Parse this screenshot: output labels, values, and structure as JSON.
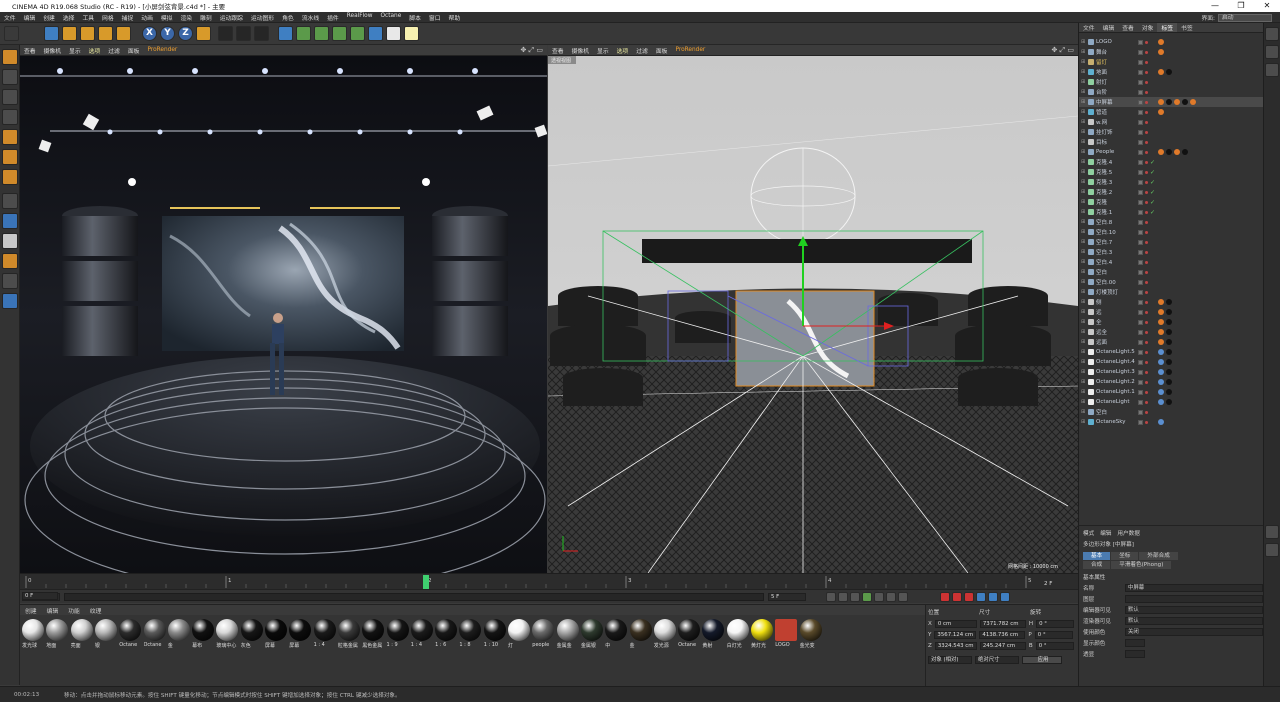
{
  "window": {
    "title": "CINEMA 4D R19.068 Studio (RC - R19) - [小屏剑弦背景.c4d *] - 主要",
    "controls": [
      "—",
      "❐",
      "✕"
    ]
  },
  "menubar": {
    "items": [
      "文件",
      "编辑",
      "创建",
      "选择",
      "工具",
      "网格",
      "捕捉",
      "动画",
      "模拟",
      "渲染",
      "雕刻",
      "运动跟踪",
      "运动图形",
      "角色",
      "流水线",
      "插件",
      "RealFlow",
      "Octane",
      "脚本",
      "窗口",
      "帮助"
    ],
    "layout_label": "界面:",
    "layout_value": "启动"
  },
  "viewport_left": {
    "menu": [
      "查看",
      "摄像机",
      "显示",
      "选项",
      "过滤",
      "面板"
    ],
    "prorender": "ProRender"
  },
  "viewport_right": {
    "menu": [
      "查看",
      "摄像机",
      "显示",
      "选项",
      "过滤",
      "面板"
    ],
    "prorender": "ProRender",
    "camera_tag": "透视视图",
    "grid_spacing": "网格间距 : 10000 cm"
  },
  "timeline": {
    "ticks": [
      "0",
      "1",
      "2",
      "3",
      "4",
      "5"
    ],
    "end_frame": "2 F",
    "current_frame": "0 F",
    "start_field": "0 F",
    "end_field": "5 F",
    "playhead_fraction": 0.4
  },
  "materials": {
    "menu": [
      "创建",
      "编辑",
      "功能",
      "纹理"
    ],
    "items": [
      {
        "label": "发光球",
        "color": "#e6e6e6"
      },
      {
        "label": "地面",
        "color": "#9a9a9a"
      },
      {
        "label": "亮面",
        "color": "#d0d0d0"
      },
      {
        "label": "银",
        "color": "#b8b8b8"
      },
      {
        "label": "Octane",
        "color": "#2c2c2c"
      },
      {
        "label": "Octane",
        "color": "#5a5a5a"
      },
      {
        "label": "金",
        "color": "#8a8a8a"
      },
      {
        "label": "幕布",
        "color": "#111111"
      },
      {
        "label": "玻璃中心",
        "color": "#d8d8d8"
      },
      {
        "label": "灰色",
        "color": "#161616"
      },
      {
        "label": "屏幕",
        "color": "#0a0a0a"
      },
      {
        "label": "屏幕",
        "color": "#0d0d0d"
      },
      {
        "label": "1 : 4",
        "color": "#1a1a1a"
      },
      {
        "label": "粒格金属",
        "color": "#3a3a3a"
      },
      {
        "label": "黑色金属",
        "color": "#121212"
      },
      {
        "label": "1 : 9",
        "color": "#151515"
      },
      {
        "label": "1 : 4",
        "color": "#1b1b1b"
      },
      {
        "label": "1 : 6",
        "color": "#181818"
      },
      {
        "label": "1 : 8",
        "color": "#1d1d1d"
      },
      {
        "label": "1 : 10",
        "color": "#141414"
      },
      {
        "label": "灯",
        "color": "#f2f2f2"
      },
      {
        "label": "people",
        "color": "#6a6a6a"
      },
      {
        "label": "金属金",
        "color": "#a8a8a8"
      },
      {
        "label": "金属银",
        "color": "#2e3a2e"
      },
      {
        "label": "中",
        "color": "#191919"
      },
      {
        "label": "金",
        "color": "#3a3020"
      },
      {
        "label": "发光源",
        "color": "#dcdcdc"
      },
      {
        "label": "Octane",
        "color": "#1e1e1e"
      },
      {
        "label": "黄射",
        "color": "#141a2a"
      },
      {
        "label": "白灯光",
        "color": "#f5f5f5"
      },
      {
        "label": "黄灯光",
        "color": "#f0e010"
      },
      {
        "label": "LOGO",
        "color": "#c04030"
      },
      {
        "label": "金光变",
        "color": "#5a4a2a"
      }
    ]
  },
  "coordinates": {
    "headers": [
      "位置",
      "尺寸",
      "旋转"
    ],
    "rows": [
      {
        "axis": "X",
        "pos": "0 cm",
        "size": "7371.782 cm",
        "rot_label": "H",
        "rot": "0 °"
      },
      {
        "axis": "Y",
        "pos": "3567.124 cm",
        "size": "4138.736 cm",
        "rot_label": "P",
        "rot": "0 °"
      },
      {
        "axis": "Z",
        "pos": "3324.543 cm",
        "size": "245.247 cm",
        "rot_label": "B",
        "rot": "0 °"
      }
    ],
    "mode_a": "对象 (相对)",
    "mode_b": "绝对尺寸",
    "apply": "应用"
  },
  "status": {
    "time": "00:02:13",
    "hint": "移动：点击并拖动鼠标移动元素。按住 SHIFT 键量化移动；节点编辑模式时按住 SHIFT 键增加选择对象；按住 CTRL 键减少选择对象。"
  },
  "object_manager": {
    "tabs": [
      "文件",
      "编辑",
      "查看",
      "对象",
      "标签",
      "书签"
    ],
    "active_tab": "标签",
    "objects": [
      {
        "name": "LOGO",
        "color": "#8fa9c4",
        "tags": 1,
        "check": ""
      },
      {
        "name": "舞台",
        "color": "#8fa9c4",
        "tags": 1,
        "check": ""
      },
      {
        "name": "留灯",
        "color": "#c8b070",
        "tags": 0,
        "check": ""
      },
      {
        "name": "地面",
        "color": "#5fb0d0",
        "tags": 2,
        "check": ""
      },
      {
        "name": "射灯",
        "color": "#8fd0a0",
        "tags": 0,
        "check": ""
      },
      {
        "name": "台阶",
        "color": "#8fa9c4",
        "tags": 0,
        "check": ""
      },
      {
        "name": "中屏幕",
        "color": "#8fa9c4",
        "tags": 5,
        "check": ""
      },
      {
        "name": "管道",
        "color": "#5fb0d0",
        "tags": 1,
        "check": ""
      },
      {
        "name": "w.网",
        "color": "#c8c8c8",
        "tags": 0,
        "check": ""
      },
      {
        "name": "挂灯饰",
        "color": "#8fa9c4",
        "tags": 0,
        "check": ""
      },
      {
        "name": "目标",
        "color": "#c8c8c8",
        "tags": 0,
        "check": ""
      },
      {
        "name": "People",
        "color": "#8fa9c4",
        "tags": 4,
        "check": ""
      },
      {
        "name": "克隆.4",
        "color": "#8fd0a0",
        "tags": 0,
        "check": "✓"
      },
      {
        "name": "克隆.5",
        "color": "#8fd0a0",
        "tags": 0,
        "check": "✓"
      },
      {
        "name": "克隆.3",
        "color": "#8fd0a0",
        "tags": 0,
        "check": "✓"
      },
      {
        "name": "克隆.2",
        "color": "#8fd0a0",
        "tags": 0,
        "check": "✓"
      },
      {
        "name": "克隆",
        "color": "#8fd0a0",
        "tags": 0,
        "check": "✓"
      },
      {
        "name": "克隆.1",
        "color": "#8fd0a0",
        "tags": 0,
        "check": "✓"
      },
      {
        "name": "空白.8",
        "color": "#8fa9c4",
        "tags": 0,
        "check": ""
      },
      {
        "name": "空白.10",
        "color": "#8fa9c4",
        "tags": 0,
        "check": ""
      },
      {
        "name": "空白.7",
        "color": "#8fa9c4",
        "tags": 0,
        "check": ""
      },
      {
        "name": "空白.3",
        "color": "#8fa9c4",
        "tags": 0,
        "check": ""
      },
      {
        "name": "空白.4",
        "color": "#8fa9c4",
        "tags": 0,
        "check": ""
      },
      {
        "name": "空白",
        "color": "#8fa9c4",
        "tags": 0,
        "check": ""
      },
      {
        "name": "空白.00",
        "color": "#8fa9c4",
        "tags": 0,
        "check": ""
      },
      {
        "name": "灯楼顶灯",
        "color": "#8fa9c4",
        "tags": 0,
        "check": ""
      },
      {
        "name": "侧",
        "color": "#c8c8c8",
        "tags": 2,
        "check": ""
      },
      {
        "name": "远",
        "color": "#c8c8c8",
        "tags": 2,
        "check": ""
      },
      {
        "name": "全",
        "color": "#c8c8c8",
        "tags": 2,
        "check": ""
      },
      {
        "name": "远全",
        "color": "#c8c8c8",
        "tags": 2,
        "check": ""
      },
      {
        "name": "远面",
        "color": "#c8c8c8",
        "tags": 2,
        "check": ""
      },
      {
        "name": "OctaneLight.5",
        "color": "#eeeeee",
        "tags": 2,
        "check": ""
      },
      {
        "name": "OctaneLight.4",
        "color": "#eeeeee",
        "tags": 2,
        "check": ""
      },
      {
        "name": "OctaneLight.3",
        "color": "#eeeeee",
        "tags": 2,
        "check": ""
      },
      {
        "name": "OctaneLight.2",
        "color": "#eeeeee",
        "tags": 2,
        "check": ""
      },
      {
        "name": "OctaneLight.1",
        "color": "#eeeeee",
        "tags": 2,
        "check": ""
      },
      {
        "name": "OctaneLight",
        "color": "#eeeeee",
        "tags": 2,
        "check": ""
      },
      {
        "name": "空白",
        "color": "#8fa9c4",
        "tags": 0,
        "check": ""
      },
      {
        "name": "OctaneSky",
        "color": "#5fb0d0",
        "tags": 1,
        "check": ""
      }
    ]
  },
  "attributes": {
    "menu": [
      "模式",
      "编辑",
      "用户数据"
    ],
    "object_type": "多边形对象 [中屏幕]",
    "tabs_row1": [
      "基本",
      "坐标",
      "外部合成"
    ],
    "tabs_row2": [
      "合成",
      "平滑着色(Phong)"
    ],
    "section": "基本属性",
    "fields": [
      {
        "label": "名称",
        "value": "中屏幕"
      },
      {
        "label": "图层",
        "value": ""
      },
      {
        "label": "编辑器可见",
        "value": "默认"
      },
      {
        "label": "渲染器可见",
        "value": "默认"
      },
      {
        "label": "使用颜色",
        "value": "关闭"
      },
      {
        "label": "显示颜色",
        "value": ""
      },
      {
        "label": "透显",
        "value": ""
      }
    ]
  },
  "colors": {
    "accent": "#4b7bb0",
    "orange": "#d89a2a",
    "playhead": "#3fcf6f"
  }
}
